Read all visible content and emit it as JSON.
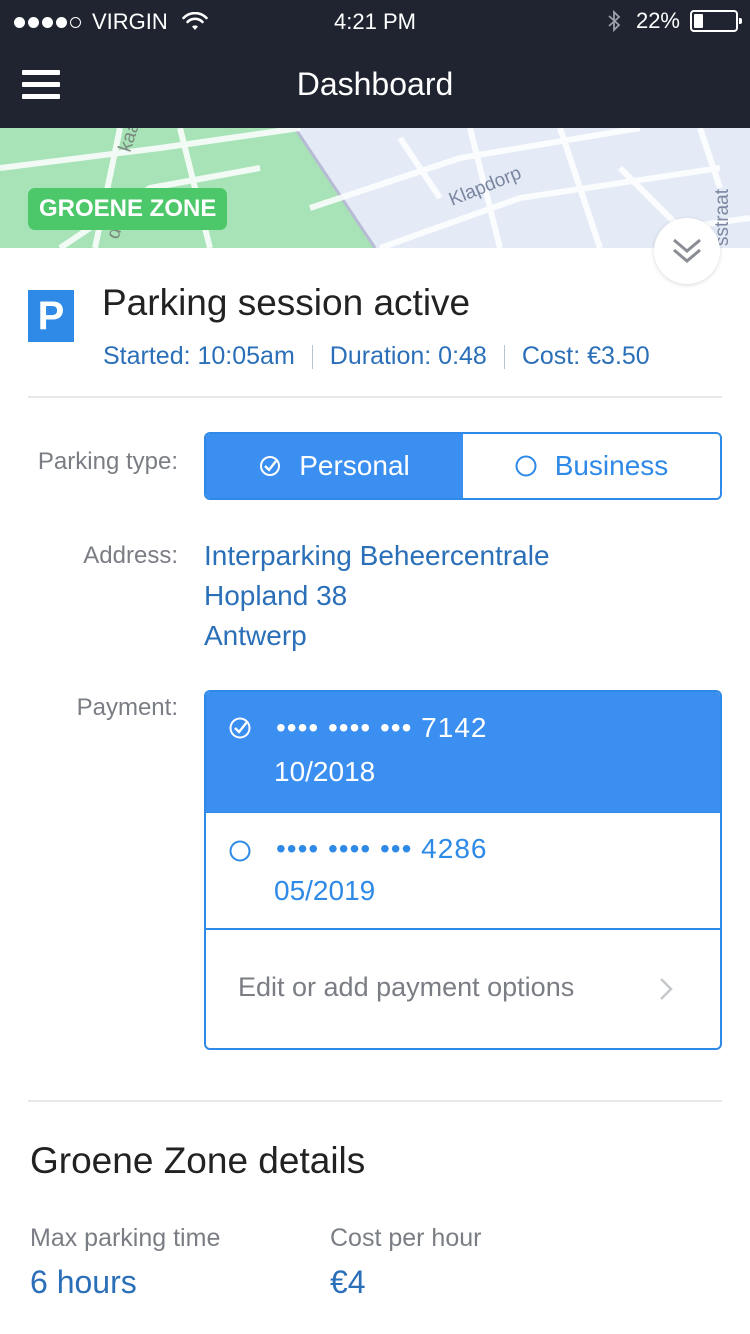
{
  "status_bar": {
    "carrier": "VIRGIN",
    "signal_filled": 4,
    "signal_total": 5,
    "time": "4:21 PM",
    "battery_percent": "22%",
    "battery_level": 0.22
  },
  "nav": {
    "title": "Dashboard",
    "menu_icon": "hamburger-menu-icon"
  },
  "map": {
    "zone_badge": "GROENE ZONE",
    "street_labels": [
      "kaai",
      "da",
      "Klapdorp",
      "sstraat"
    ],
    "collapse_icon": "double-chevron-down-icon"
  },
  "session": {
    "icon": "P",
    "title": "Parking session active",
    "started": "Started: 10:05am",
    "duration": "Duration: 0:48",
    "cost": "Cost: €3.50"
  },
  "form": {
    "parking_type_label": "Parking type:",
    "parking_type_options": [
      {
        "label": "Personal",
        "selected": true
      },
      {
        "label": "Business",
        "selected": false
      }
    ],
    "address_label": "Address:",
    "address_lines": [
      "Interparking Beheercentrale",
      "Hopland 38",
      "Antwerp"
    ],
    "payment_label": "Payment:",
    "payment_methods": [
      {
        "number": "•••• •••• ••• 7142",
        "expiry": "10/2018",
        "selected": true
      },
      {
        "number": "•••• •••• ••• 4286",
        "expiry": "05/2019",
        "selected": false
      }
    ],
    "edit_payment": "Edit or add payment options"
  },
  "zone_details": {
    "title": "Groene Zone details",
    "max_time_label": "Max parking time",
    "max_time_value": "6 hours",
    "cost_label": "Cost per hour",
    "cost_value": "€4"
  },
  "colors": {
    "nav_bg": "#1f2430",
    "accent": "#3a8ff0",
    "link_text": "#2a6fb8",
    "zone_green": "#4cc86a"
  }
}
